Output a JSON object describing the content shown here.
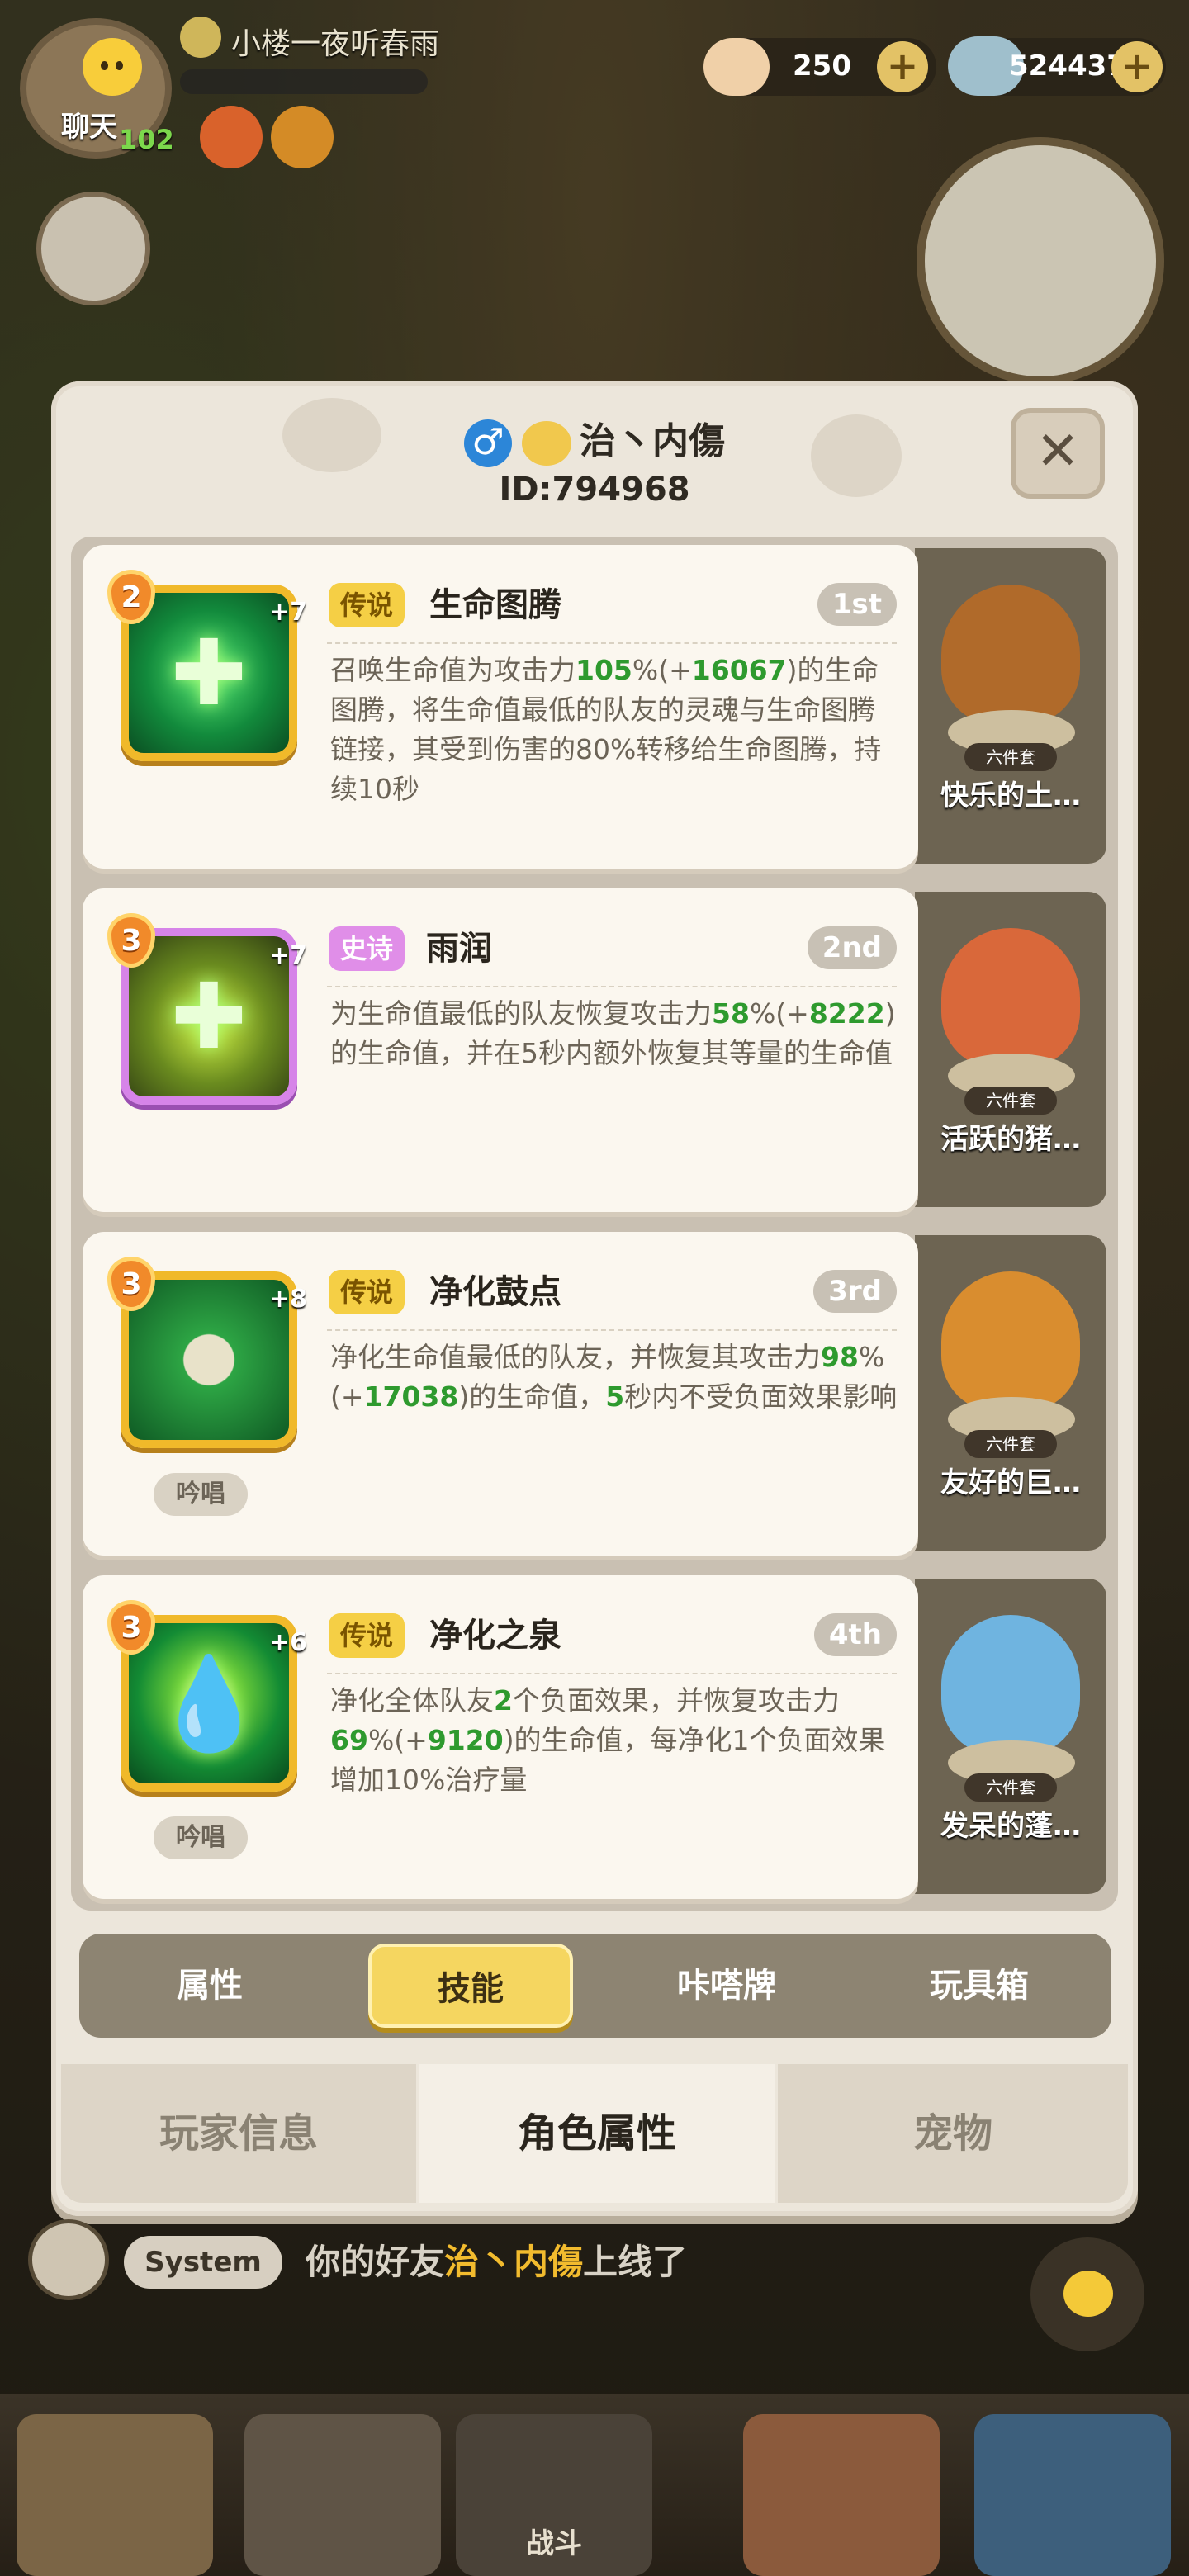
{
  "hud": {
    "chat_label": "聊天",
    "level": "102",
    "player_name": "小楼一夜听春雨",
    "resource1_value": "250",
    "resource2_value": "524437"
  },
  "profile": {
    "name": "治丶内傷",
    "gender_symbol": "♂",
    "id": "ID:794968",
    "close_symbol": "✕"
  },
  "skills": [
    {
      "level": "2",
      "plus": "+7",
      "rarity": "传说",
      "name": "生命图腾",
      "rank": "1st",
      "desc": [
        {
          "t": "召唤生命值为攻击力"
        },
        {
          "t": "105",
          "h": true
        },
        {
          "t": "%(+"
        },
        {
          "t": "16067",
          "h": true
        },
        {
          "t": ")的生命图腾，将生命值最低的队友的灵魂与生命图腾链接，其受到伤害的80%转移给生命图腾，持续10秒"
        }
      ],
      "chant": ""
    },
    {
      "level": "3",
      "plus": "+7",
      "rarity": "史诗",
      "name": "雨润",
      "rank": "2nd",
      "desc": [
        {
          "t": "为生命值最低的队友恢复攻击力"
        },
        {
          "t": "58",
          "h": true
        },
        {
          "t": "%(+"
        },
        {
          "t": "8222",
          "h": true
        },
        {
          "t": ")的生命值，并在5秒内额外恢复其等量的生命值"
        }
      ],
      "chant": ""
    },
    {
      "level": "3",
      "plus": "+8",
      "rarity": "传说",
      "name": "净化鼓点",
      "rank": "3rd",
      "desc": [
        {
          "t": "净化生命值最低的队友，并恢复其攻击力"
        },
        {
          "t": "98",
          "h": true
        },
        {
          "t": "%(+"
        },
        {
          "t": "17038",
          "h": true
        },
        {
          "t": ")的生命值，"
        },
        {
          "t": "5",
          "h": true
        },
        {
          "t": "秒内不受负面效果影响"
        }
      ],
      "chant": "吟唱"
    },
    {
      "level": "3",
      "plus": "+6",
      "rarity": "传说",
      "name": "净化之泉",
      "rank": "4th",
      "desc": [
        {
          "t": "净化全体队友"
        },
        {
          "t": "2",
          "h": true
        },
        {
          "t": "个负面效果，并恢复攻击力"
        },
        {
          "t": "69",
          "h": true
        },
        {
          "t": "%(+"
        },
        {
          "t": "9120",
          "h": true
        },
        {
          "t": ")的生命值，每净化1个负面效果增加10%治疗量"
        }
      ],
      "chant": "吟唱"
    }
  ],
  "pets": [
    {
      "tag": "六件套",
      "name": "快乐的土…",
      "color": "#b06a2a"
    },
    {
      "tag": "六件套",
      "name": "活跃的猪…",
      "color": "#d9683a"
    },
    {
      "tag": "六件套",
      "name": "友好的巨…",
      "color": "#d98d2f"
    },
    {
      "tag": "六件套",
      "name": "发呆的蓬…",
      "color": "#6fb4e0"
    }
  ],
  "subtabs": [
    "属性",
    "技能",
    "咔嗒牌",
    "玩具箱"
  ],
  "bottom_tabs": [
    "玩家信息",
    "角色属性",
    "宠物"
  ],
  "system": {
    "tag": "System",
    "msg_pre": "你的好友",
    "friend": "治丶内傷",
    "msg_post": "上线了"
  },
  "nav": {
    "battle_label": "战斗"
  }
}
